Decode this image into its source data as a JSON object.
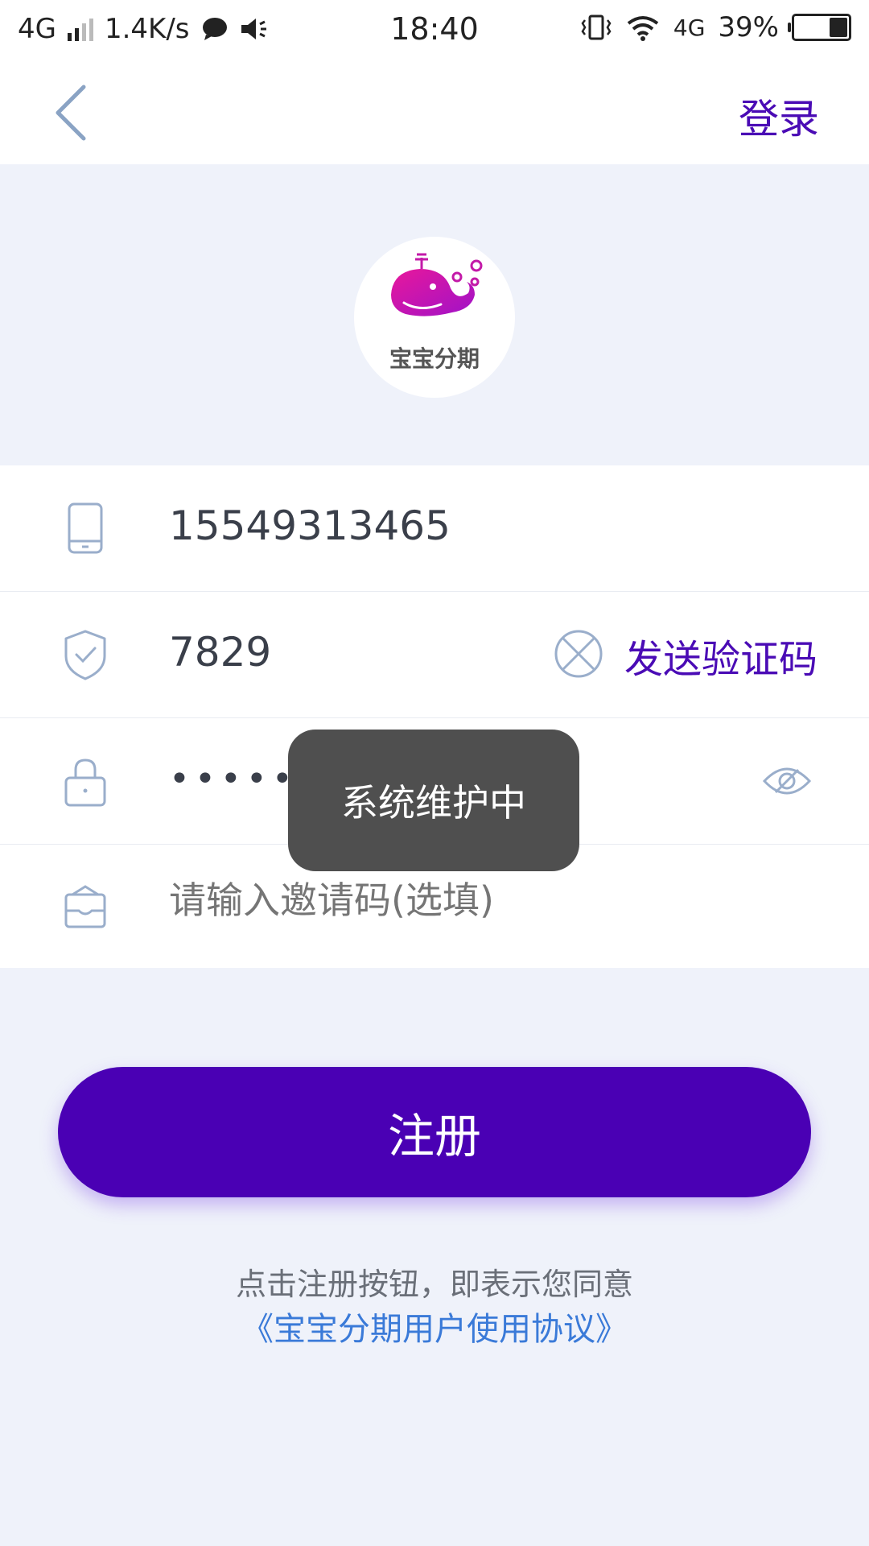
{
  "status_bar": {
    "network": "4G",
    "speed": "1.4K/s",
    "time": "18:40",
    "network2": "4G",
    "battery": "39%"
  },
  "header": {
    "login_label": "登录"
  },
  "logo": {
    "caption": "宝宝分期"
  },
  "form": {
    "phone_value": "15549313465",
    "code_value": "7829",
    "send_code_label": "发送验证码",
    "password_value": "••••••••",
    "invite_placeholder": "请输入邀请码(选填)"
  },
  "toast": {
    "message": "系统维护中"
  },
  "register_button_label": "注册",
  "agreement": {
    "text": "点击注册按钮，即表示您同意",
    "link": "《宝宝分期用户使用协议》"
  },
  "colors": {
    "primary": "#4a00b4",
    "link": "#3a7ad8",
    "background": "#eff2fa"
  }
}
